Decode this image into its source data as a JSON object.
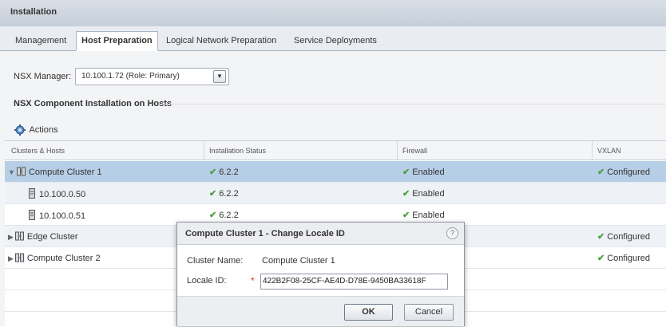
{
  "panel": {
    "title": "Installation"
  },
  "tabs": [
    {
      "label": "Management"
    },
    {
      "label": "Host Preparation"
    },
    {
      "label": "Logical Network Preparation"
    },
    {
      "label": "Service Deployments"
    }
  ],
  "manager": {
    "label": "NSX Manager:",
    "selected": "10.100.1.72 (Role: Primary)"
  },
  "section": {
    "title": "NSX Component Installation on Hosts"
  },
  "toolbar": {
    "actions_label": "Actions"
  },
  "grid": {
    "headers": [
      "Clusters & Hosts",
      "Installation Status",
      "Firewall",
      "VXLAN"
    ],
    "rows": [
      {
        "name": "Compute Cluster 1",
        "install": "6.2.2",
        "firewall": "Enabled",
        "vxlan": "Configured"
      },
      {
        "name": "10.100.0.50",
        "install": "6.2.2",
        "firewall": "Enabled",
        "vxlan": ""
      },
      {
        "name": "10.100.0.51",
        "install": "6.2.2",
        "firewall": "Enabled",
        "vxlan": ""
      },
      {
        "name": "Edge Cluster",
        "install": "",
        "firewall": "",
        "vxlan": "Configured"
      },
      {
        "name": "Compute Cluster 2",
        "install": "",
        "firewall": "",
        "vxlan": "Configured"
      }
    ]
  },
  "dialog": {
    "title": "Compute Cluster 1 - Change Locale ID",
    "help": "?",
    "cluster_label": "Cluster Name:",
    "cluster_value": "Compute Cluster 1",
    "locale_label": "Locale ID:",
    "required_mark": "*",
    "locale_value": "422B2F08-25CF-AE4D-D78E-9450BA33618F",
    "ok_label": "OK",
    "cancel_label": "Cancel"
  },
  "colors": {
    "selected_row": "#b7cee7",
    "check": "#4aa03c",
    "required": "#dd3333"
  }
}
